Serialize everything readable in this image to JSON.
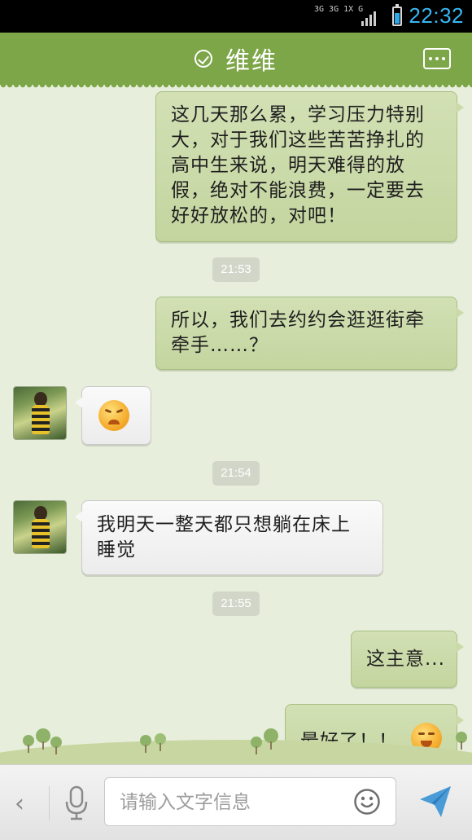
{
  "status_bar": {
    "network_label": "3G 3G 1X G",
    "battery_level": 0.7,
    "time": "22:32"
  },
  "header": {
    "status_icon": "check-circle-icon",
    "title": "维维",
    "more_icon": "more-dots-icon"
  },
  "messages": {
    "m1": {
      "direction": "out",
      "text": "这几天那么累，学习压力特别大，对于我们这些苦苦挣扎的高中生来说，明天难得的放假，绝对不能浪费，一定要去好好放松的，对吧！"
    },
    "t1": "21:53",
    "m2": {
      "direction": "out",
      "text": "所以，我们去约约会逛逛街牵牵手……？"
    },
    "m3": {
      "direction": "in",
      "emoji": "angry-face-emoji"
    },
    "t2": "21:54",
    "m4": {
      "direction": "in",
      "text": "我明天一整天都只想躺在床上睡觉"
    },
    "t3": "21:55",
    "m5": {
      "direction": "out",
      "text": "这主意..."
    },
    "m6": {
      "direction": "out",
      "text": "最好了！！",
      "emoji": "crying-face-emoji"
    }
  },
  "input_bar": {
    "back_icon": "chevron-left-icon",
    "voice_icon": "microphone-icon",
    "placeholder": "请输入文字信息",
    "emoji_icon": "smiley-icon",
    "send_icon": "send-icon"
  },
  "colors": {
    "header_bg": "#7ca647",
    "out_bubble": "#c9d9a6",
    "in_bubble": "#f4f4f4",
    "chat_bg": "#e7eedb",
    "time_accent": "#39b7f2"
  }
}
